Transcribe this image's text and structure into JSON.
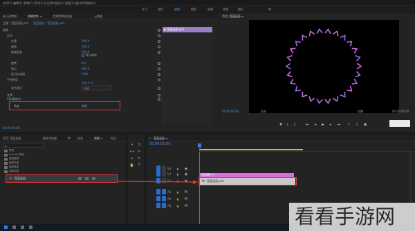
{
  "menu": {
    "items": [
      "文件(F)",
      "编辑(E)",
      "剪辑(C)",
      "序列(S)",
      "标记(M)",
      "图形(G)",
      "视图(V)",
      "窗口(W)",
      "帮助(H)"
    ],
    "workspaces": [
      "学习",
      "组件",
      "编辑",
      "颜色",
      "效果",
      "音频",
      "图形",
      "库"
    ]
  },
  "effect_controls": {
    "tabs": [
      "效果控件 ≡",
      "音频剪辑混合器",
      "元数据"
    ],
    "tab_extra": "源:(无剪辑)",
    "source_label": "主要 * 莹蓝画面.psd",
    "clip_label": "莹蓝画面 * 莹蓝画面.psd",
    "clip_bar": "▶ 莹蓝画面.psd",
    "sections": [
      "视频",
      "运动",
      "位置",
      "缩放",
      "缩放宽度",
      "等比缩放",
      "旋转",
      "锚点",
      "防闪烁滤镜",
      "不透明度",
      "时间重映射",
      "变换",
      "混合模式",
      "设置"
    ],
    "values": [
      "300.0",
      "100.0",
      "100.0",
      "0.0",
      "960.0",
      "0.00",
      "100.0 %",
      "正常"
    ],
    "checkbox_label": "等比缩放",
    "setting_label": "角度",
    "setting_value": "数值",
    "timecode": "00:00:00:00"
  },
  "program": {
    "title": "节目: 莹蓝画面 ≡",
    "timecode_left": "00:00:00:00",
    "timecode_right": "00:00:05:00",
    "fit_label": "适合",
    "quality": "完整"
  },
  "project": {
    "tabs": [
      "项目: 莹蓝画面",
      "媒体浏览器",
      "库",
      "信息",
      "效果 ≡",
      "标记"
    ],
    "search_placeholder": "",
    "folders": [
      "预设",
      "Lumetri 预设",
      "音频效果",
      "音频过渡",
      "视频效果",
      "视频过渡"
    ],
    "selected_item": "莹蓝画面"
  },
  "timeline": {
    "tab": "莹蓝画面 ≡",
    "timecode": "00:00:00:00",
    "tracks": [
      "V3",
      "V2",
      "V1",
      "A1",
      "A2",
      "A3"
    ],
    "clip_top": "莹蓝画面.psd",
    "clip_main": "莹蓝画面.psd"
  },
  "watermark": "看看手游网",
  "colors": {
    "accent_blue": "#2a6cc7",
    "annotation_red": "#e13a3a",
    "clip_pink": "#e06be0",
    "clip_gray": "#c8c8c8",
    "ring_color": "#c070e8"
  }
}
